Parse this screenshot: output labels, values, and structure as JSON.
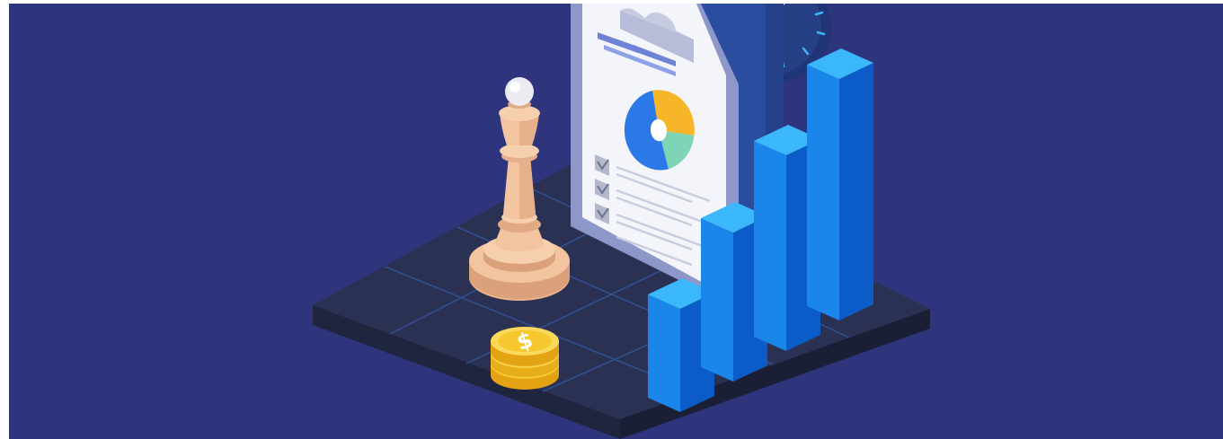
{
  "colors": {
    "background": "#2e357c",
    "platform_top": "#2b3152",
    "platform_side_left": "#20253f",
    "platform_side_right": "#1a1f36",
    "grid_line": "#33579e",
    "bar_front": "#1b86ea",
    "bar_side": "#0b5bc8",
    "bar_top": "#3ab8fb",
    "pie_blue": "#2b79e6",
    "pie_yellow": "#f7b52a",
    "pie_green": "#7dd5b6",
    "chess_piece": "#f2c4a0",
    "coin": "#f6c72e",
    "clipboard": "#f4f5fb",
    "clock": "#1f3576"
  },
  "icons": [
    "chess-queen-icon",
    "dollar-coin-icon",
    "clipboard-report-icon",
    "pie-chart-icon",
    "checkbox-icon",
    "bar-chart-icon",
    "clock-icon"
  ],
  "bar_levels": [
    0.36,
    0.52,
    0.68,
    0.84
  ],
  "coin_symbol": "$"
}
